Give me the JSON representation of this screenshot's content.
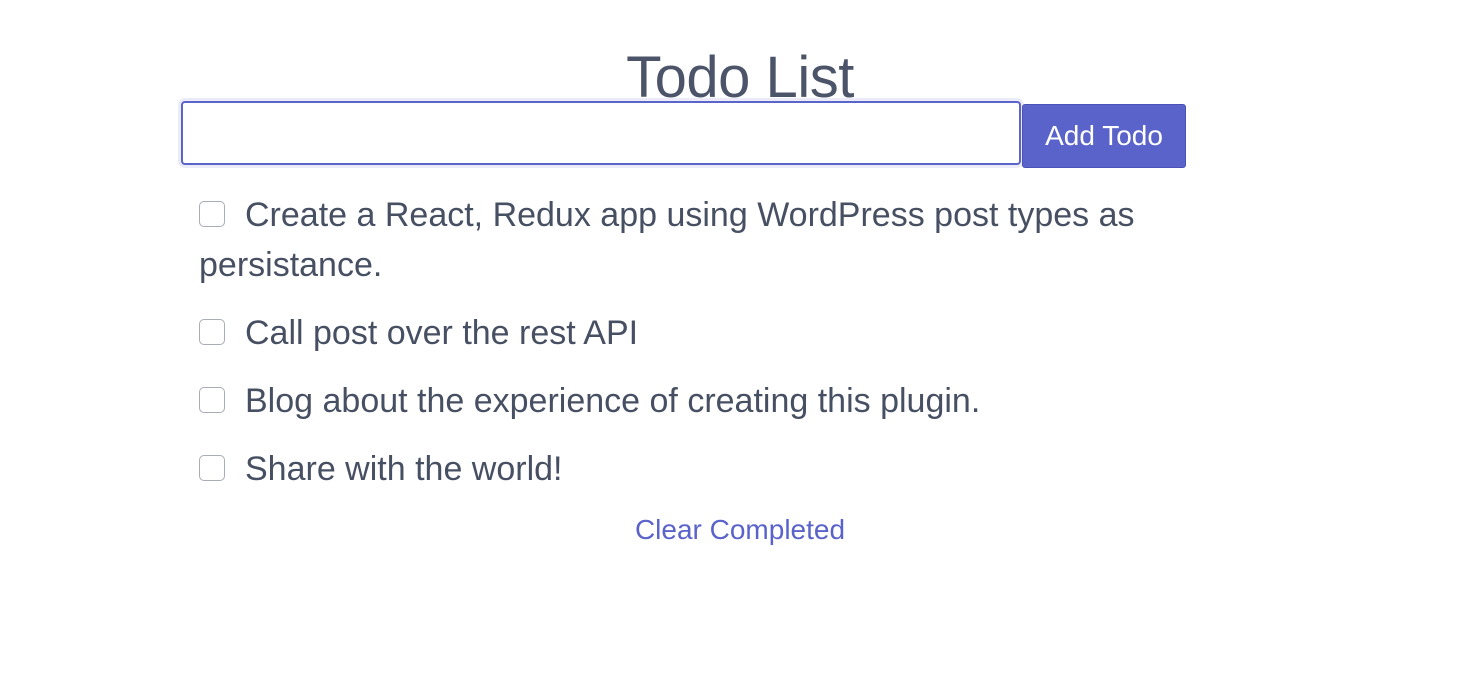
{
  "page": {
    "title": "Todo List"
  },
  "form": {
    "input_value": "",
    "input_placeholder": "",
    "add_button_label": "Add Todo"
  },
  "todos": [
    {
      "text": "Create a React, Redux app using WordPress post types as persistance.",
      "completed": false
    },
    {
      "text": "Call post over the rest API",
      "completed": false
    },
    {
      "text": "Blog about the experience of creating this plugin.",
      "completed": false
    },
    {
      "text": "Share with the world!",
      "completed": false
    }
  ],
  "footer": {
    "clear_completed_label": "Clear Completed"
  },
  "colors": {
    "accent": "#5a63c9",
    "text": "#475063",
    "checkbox_border": "#a9adb6"
  }
}
